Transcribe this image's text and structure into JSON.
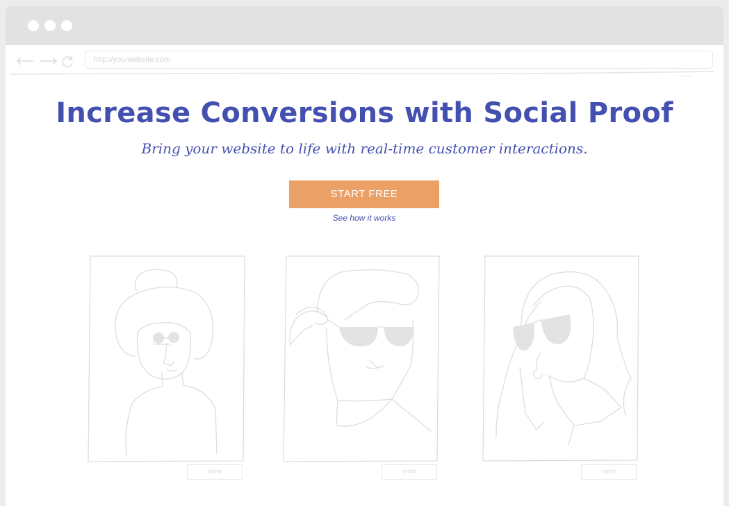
{
  "browser": {
    "url_placeholder": "http://yourwebsite.com"
  },
  "hero": {
    "headline": "Increase Conversions with Social Proof",
    "subheadline": "Bring your website to life with real-time customer interactions.",
    "cta_label": "START FREE",
    "secondary_link": "See how it works"
  },
  "portraits": [
    {
      "view_label": "view"
    },
    {
      "view_label": "view"
    },
    {
      "view_label": "view"
    }
  ],
  "colors": {
    "brand": "#4450b0",
    "cta": "#eba066",
    "sketch_line": "#dddddd",
    "lens_fill": "#e3e3e3"
  }
}
